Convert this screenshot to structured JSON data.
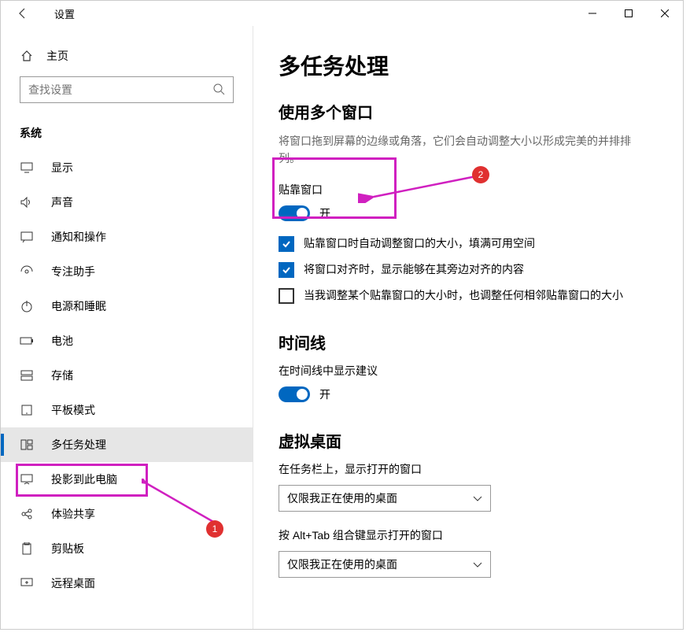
{
  "window": {
    "title": "设置"
  },
  "sidebar": {
    "home": "主页",
    "search_placeholder": "查找设置",
    "group": "系统",
    "items": [
      {
        "label": "显示"
      },
      {
        "label": "声音"
      },
      {
        "label": "通知和操作"
      },
      {
        "label": "专注助手"
      },
      {
        "label": "电源和睡眠"
      },
      {
        "label": "电池"
      },
      {
        "label": "存储"
      },
      {
        "label": "平板模式"
      },
      {
        "label": "多任务处理"
      },
      {
        "label": "投影到此电脑"
      },
      {
        "label": "体验共享"
      },
      {
        "label": "剪贴板"
      },
      {
        "label": "远程桌面"
      }
    ]
  },
  "main": {
    "title": "多任务处理",
    "snap": {
      "title": "使用多个窗口",
      "desc": "将窗口拖到屏幕的边缘或角落，它们会自动调整大小以形成完美的并排排列。",
      "label": "贴靠窗口",
      "toggle_state": "开",
      "opt1": "贴靠窗口时自动调整窗口的大小，填满可用空间",
      "opt2": "将窗口对齐时，显示能够在其旁边对齐的内容",
      "opt3": "当我调整某个贴靠窗口的大小时，也调整任何相邻贴靠窗口的大小"
    },
    "timeline": {
      "title": "时间线",
      "label": "在时间线中显示建议",
      "toggle_state": "开"
    },
    "virtual": {
      "title": "虚拟桌面",
      "label1": "在任务栏上，显示打开的窗口",
      "select1": "仅限我正在使用的桌面",
      "label2": "按 Alt+Tab 组合键显示打开的窗口",
      "select2": "仅限我正在使用的桌面"
    }
  },
  "annotations": {
    "n1": "1",
    "n2": "2"
  }
}
